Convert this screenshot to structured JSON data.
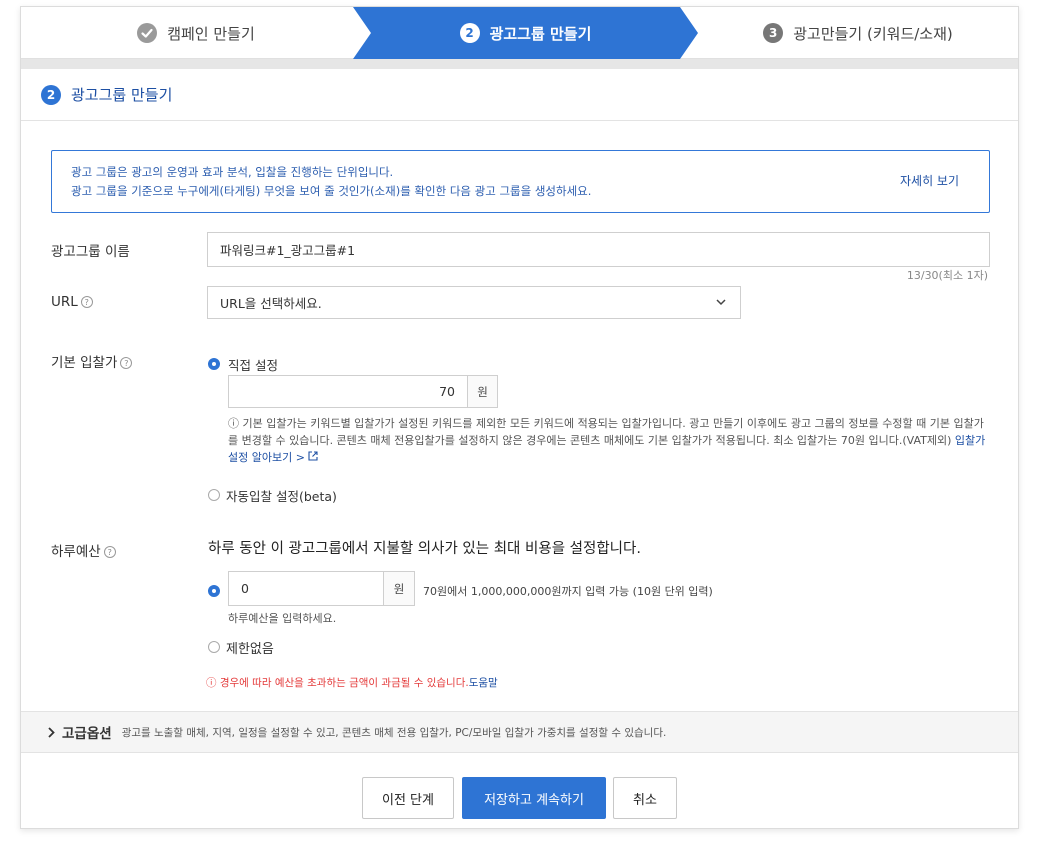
{
  "stepper": {
    "step1": {
      "label": "캠페인 만들기",
      "icon": "check-circle"
    },
    "step2": {
      "num": "2",
      "label": "광고그룹 만들기"
    },
    "step3": {
      "num": "3",
      "label": "광고만들기 (키워드/소재)"
    }
  },
  "section": {
    "num": "2",
    "title": "광고그룹 만들기"
  },
  "info": {
    "line1": "광고 그룹은 광고의 운영과 효과 분석, 입찰을 진행하는 단위입니다.",
    "line2": "광고 그룹을 기준으로 누구에게(타게팅) 무엇을 보여 줄 것인가(소재)를 확인한 다음 광고 그룹을 생성하세요.",
    "more_link": "자세히 보기"
  },
  "group_name": {
    "label": "광고그룹 이름",
    "value": "파워링크#1_광고그룹#1",
    "counter": "13/30(최소 1자)"
  },
  "url": {
    "label": "URL",
    "placeholder": "URL을 선택하세요."
  },
  "bid": {
    "label": "기본 입찰가",
    "manual_label": "직접 설정",
    "value": "70",
    "unit": "원",
    "note": "ⓘ 기본 입찰가는 키워드별 입찰가가 설정된 키워드를 제외한 모든 키워드에 적용되는 입찰가입니다. 광고 만들기 이후에도 광고 그룹의 정보를 수정할 때 기본 입찰가를 변경할 수 있습니다. 콘텐츠 매체 전용입찰가를 설정하지 않은 경우에는 콘텐츠 매체에도 기본 입찰가가 적용됩니다. 최소 입찰가는 70원 입니다.(VAT제외)",
    "note_link": "입찰가 설정 알아보기 >",
    "auto_label": "자동입찰 설정(beta)"
  },
  "budget": {
    "label": "하루예산",
    "description": "하루 동안 이 광고그룹에서 지불할 의사가 있는 최대 비용을 설정합니다.",
    "value": "0",
    "unit": "원",
    "range": "70원에서 1,000,000,000원까지 입력 가능 (10원 단위 입력)",
    "hint": "하루예산을 입력하세요.",
    "unlimited_label": "제한없음",
    "warning": "ⓘ 경우에 따라 예산을 초과하는 금액이 과금될 수 있습니다.",
    "warning_link": "도움말"
  },
  "advanced": {
    "label": "고급옵션",
    "description": "광고를 노출할 매체, 지역, 일정을 설정할 수 있고, 콘텐츠 매체 전용 입찰가, PC/모바일 입찰가 가중치를 설정할 수 있습니다."
  },
  "buttons": {
    "prev": "이전 단계",
    "save": "저장하고 계속하기",
    "cancel": "취소"
  },
  "colors": {
    "accent": "#2e74d4",
    "warning": "#e43a3a"
  }
}
